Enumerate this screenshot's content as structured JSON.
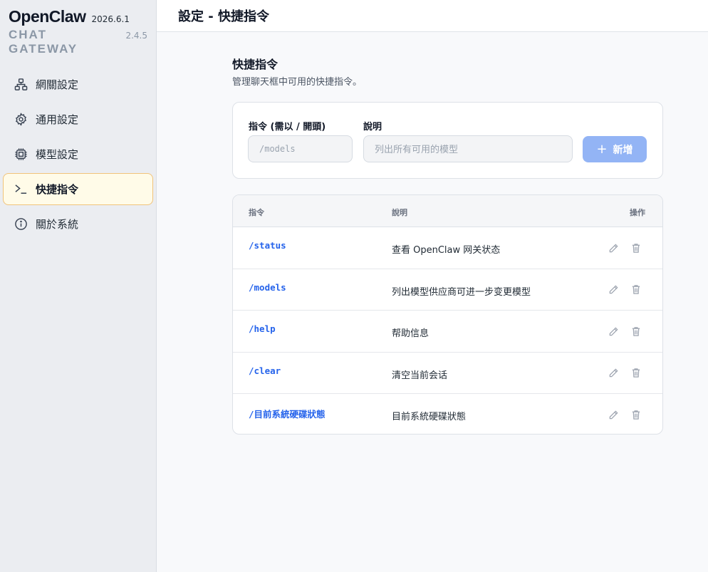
{
  "brand": {
    "name": "OpenClaw",
    "version": "2026.6.1",
    "subtitle": "CHAT GATEWAY",
    "subversion": "2.4.5"
  },
  "sidebar": {
    "items": [
      {
        "label": "網關設定",
        "icon": "network-icon",
        "active": false
      },
      {
        "label": "通用設定",
        "icon": "gear-icon",
        "active": false
      },
      {
        "label": "模型設定",
        "icon": "chip-icon",
        "active": false
      },
      {
        "label": "快捷指令",
        "icon": "terminal-icon",
        "active": true
      },
      {
        "label": "關於系統",
        "icon": "info-icon",
        "active": false
      }
    ]
  },
  "header": {
    "title": "設定 - 快捷指令"
  },
  "section": {
    "title": "快捷指令",
    "description": "管理聊天框中可用的快捷指令。"
  },
  "form": {
    "command_label": "指令 (需以 / 開頭)",
    "command_placeholder": "/models",
    "desc_label": "說明",
    "desc_placeholder": "列出所有可用的模型",
    "add_label": "新增"
  },
  "table": {
    "headers": {
      "command": "指令",
      "description": "說明",
      "actions": "操作"
    },
    "rows": [
      {
        "command": "/status",
        "description": "查看 OpenClaw 网关状态"
      },
      {
        "command": "/models",
        "description": "列出模型供应商可进一步变更模型"
      },
      {
        "command": "/help",
        "description": "帮助信息"
      },
      {
        "command": "/clear",
        "description": "清空当前会话"
      },
      {
        "command": "/目前系統硬碟狀態",
        "description": "目前系統硬碟狀態"
      }
    ]
  },
  "colors": {
    "accent": "#2563eb",
    "add_button": "#93b4f5",
    "active_nav_bg": "#fffbe8",
    "active_nav_border": "#f1c37a"
  }
}
